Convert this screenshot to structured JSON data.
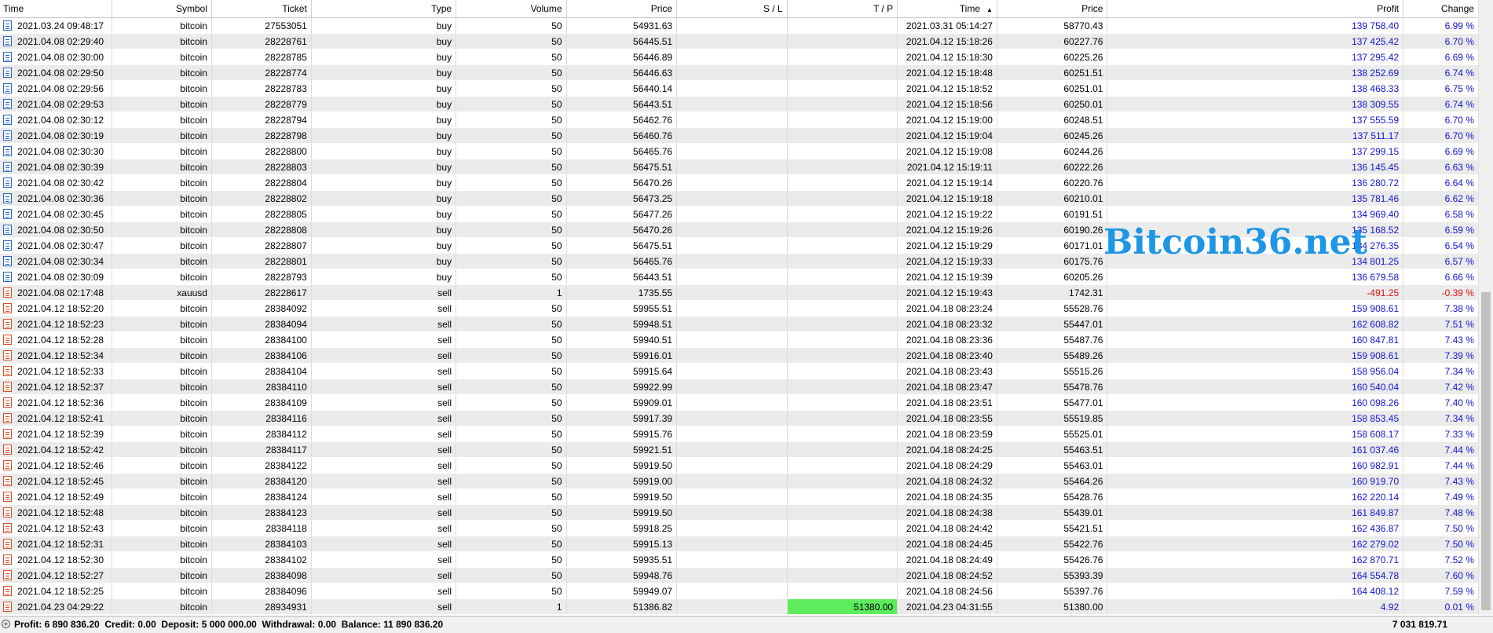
{
  "columns": {
    "time": "Time",
    "symbol": "Symbol",
    "ticket": "Ticket",
    "type": "Type",
    "volume": "Volume",
    "price": "Price",
    "sl": "S / L",
    "tp": "T / P",
    "close_time": "Time",
    "close_price": "Price",
    "profit": "Profit",
    "change": "Change"
  },
  "rows": [
    {
      "time": "2021.03.24 09:48:17",
      "symbol": "bitcoin",
      "ticket": "27553051",
      "type": "buy",
      "volume": "50",
      "price": "54931.63",
      "sl": "",
      "tp": "",
      "close_time": "2021.03.31 05:14:27",
      "close_price": "58770.43",
      "profit": "139 758.40",
      "change": "6.99 %"
    },
    {
      "time": "2021.04.08 02:29:40",
      "symbol": "bitcoin",
      "ticket": "28228761",
      "type": "buy",
      "volume": "50",
      "price": "56445.51",
      "sl": "",
      "tp": "",
      "close_time": "2021.04.12 15:18:26",
      "close_price": "60227.76",
      "profit": "137 425.42",
      "change": "6.70 %"
    },
    {
      "time": "2021.04.08 02:30:00",
      "symbol": "bitcoin",
      "ticket": "28228785",
      "type": "buy",
      "volume": "50",
      "price": "56446.89",
      "sl": "",
      "tp": "",
      "close_time": "2021.04.12 15:18:30",
      "close_price": "60225.26",
      "profit": "137 295.42",
      "change": "6.69 %"
    },
    {
      "time": "2021.04.08 02:29:50",
      "symbol": "bitcoin",
      "ticket": "28228774",
      "type": "buy",
      "volume": "50",
      "price": "56446.63",
      "sl": "",
      "tp": "",
      "close_time": "2021.04.12 15:18:48",
      "close_price": "60251.51",
      "profit": "138 252.69",
      "change": "6.74 %"
    },
    {
      "time": "2021.04.08 02:29:56",
      "symbol": "bitcoin",
      "ticket": "28228783",
      "type": "buy",
      "volume": "50",
      "price": "56440.14",
      "sl": "",
      "tp": "",
      "close_time": "2021.04.12 15:18:52",
      "close_price": "60251.01",
      "profit": "138 468.33",
      "change": "6.75 %"
    },
    {
      "time": "2021.04.08 02:29:53",
      "symbol": "bitcoin",
      "ticket": "28228779",
      "type": "buy",
      "volume": "50",
      "price": "56443.51",
      "sl": "",
      "tp": "",
      "close_time": "2021.04.12 15:18:56",
      "close_price": "60250.01",
      "profit": "138 309.55",
      "change": "6.74 %"
    },
    {
      "time": "2021.04.08 02:30:12",
      "symbol": "bitcoin",
      "ticket": "28228794",
      "type": "buy",
      "volume": "50",
      "price": "56462.76",
      "sl": "",
      "tp": "",
      "close_time": "2021.04.12 15:19:00",
      "close_price": "60248.51",
      "profit": "137 555.59",
      "change": "6.70 %"
    },
    {
      "time": "2021.04.08 02:30:19",
      "symbol": "bitcoin",
      "ticket": "28228798",
      "type": "buy",
      "volume": "50",
      "price": "56460.76",
      "sl": "",
      "tp": "",
      "close_time": "2021.04.12 15:19:04",
      "close_price": "60245.26",
      "profit": "137 511.17",
      "change": "6.70 %"
    },
    {
      "time": "2021.04.08 02:30:30",
      "symbol": "bitcoin",
      "ticket": "28228800",
      "type": "buy",
      "volume": "50",
      "price": "56465.76",
      "sl": "",
      "tp": "",
      "close_time": "2021.04.12 15:19:08",
      "close_price": "60244.26",
      "profit": "137 299.15",
      "change": "6.69 %"
    },
    {
      "time": "2021.04.08 02:30:39",
      "symbol": "bitcoin",
      "ticket": "28228803",
      "type": "buy",
      "volume": "50",
      "price": "56475.51",
      "sl": "",
      "tp": "",
      "close_time": "2021.04.12 15:19:11",
      "close_price": "60222.26",
      "profit": "136 145.45",
      "change": "6.63 %"
    },
    {
      "time": "2021.04.08 02:30:42",
      "symbol": "bitcoin",
      "ticket": "28228804",
      "type": "buy",
      "volume": "50",
      "price": "56470.26",
      "sl": "",
      "tp": "",
      "close_time": "2021.04.12 15:19:14",
      "close_price": "60220.76",
      "profit": "136 280.72",
      "change": "6.64 %"
    },
    {
      "time": "2021.04.08 02:30:36",
      "symbol": "bitcoin",
      "ticket": "28228802",
      "type": "buy",
      "volume": "50",
      "price": "56473.25",
      "sl": "",
      "tp": "",
      "close_time": "2021.04.12 15:19:18",
      "close_price": "60210.01",
      "profit": "135 781.46",
      "change": "6.62 %"
    },
    {
      "time": "2021.04.08 02:30:45",
      "symbol": "bitcoin",
      "ticket": "28228805",
      "type": "buy",
      "volume": "50",
      "price": "56477.26",
      "sl": "",
      "tp": "",
      "close_time": "2021.04.12 15:19:22",
      "close_price": "60191.51",
      "profit": "134 969.40",
      "change": "6.58 %"
    },
    {
      "time": "2021.04.08 02:30:50",
      "symbol": "bitcoin",
      "ticket": "28228808",
      "type": "buy",
      "volume": "50",
      "price": "56470.26",
      "sl": "",
      "tp": "",
      "close_time": "2021.04.12 15:19:26",
      "close_price": "60190.26",
      "profit": "135 168.52",
      "change": "6.59 %"
    },
    {
      "time": "2021.04.08 02:30:47",
      "symbol": "bitcoin",
      "ticket": "28228807",
      "type": "buy",
      "volume": "50",
      "price": "56475.51",
      "sl": "",
      "tp": "",
      "close_time": "2021.04.12 15:19:29",
      "close_price": "60171.01",
      "profit": "134 276.35",
      "change": "6.54 %"
    },
    {
      "time": "2021.04.08 02:30:34",
      "symbol": "bitcoin",
      "ticket": "28228801",
      "type": "buy",
      "volume": "50",
      "price": "56465.76",
      "sl": "",
      "tp": "",
      "close_time": "2021.04.12 15:19:33",
      "close_price": "60175.76",
      "profit": "134 801.25",
      "change": "6.57 %"
    },
    {
      "time": "2021.04.08 02:30:09",
      "symbol": "bitcoin",
      "ticket": "28228793",
      "type": "buy",
      "volume": "50",
      "price": "56443.51",
      "sl": "",
      "tp": "",
      "close_time": "2021.04.12 15:19:39",
      "close_price": "60205.26",
      "profit": "136 679.58",
      "change": "6.66 %"
    },
    {
      "time": "2021.04.08 02:17:48",
      "symbol": "xauusd",
      "ticket": "28228617",
      "type": "sell",
      "volume": "1",
      "price": "1735.55",
      "sl": "",
      "tp": "",
      "close_time": "2021.04.12 15:19:43",
      "close_price": "1742.31",
      "profit": "-491.25",
      "change": "-0.39 %"
    },
    {
      "time": "2021.04.12 18:52:20",
      "symbol": "bitcoin",
      "ticket": "28384092",
      "type": "sell",
      "volume": "50",
      "price": "59955.51",
      "sl": "",
      "tp": "",
      "close_time": "2021.04.18 08:23:24",
      "close_price": "55528.76",
      "profit": "159 908.61",
      "change": "7.38 %"
    },
    {
      "time": "2021.04.12 18:52:23",
      "symbol": "bitcoin",
      "ticket": "28384094",
      "type": "sell",
      "volume": "50",
      "price": "59948.51",
      "sl": "",
      "tp": "",
      "close_time": "2021.04.18 08:23:32",
      "close_price": "55447.01",
      "profit": "162 608.82",
      "change": "7.51 %"
    },
    {
      "time": "2021.04.12 18:52:28",
      "symbol": "bitcoin",
      "ticket": "28384100",
      "type": "sell",
      "volume": "50",
      "price": "59940.51",
      "sl": "",
      "tp": "",
      "close_time": "2021.04.18 08:23:36",
      "close_price": "55487.76",
      "profit": "160 847.81",
      "change": "7.43 %"
    },
    {
      "time": "2021.04.12 18:52:34",
      "symbol": "bitcoin",
      "ticket": "28384106",
      "type": "sell",
      "volume": "50",
      "price": "59916.01",
      "sl": "",
      "tp": "",
      "close_time": "2021.04.18 08:23:40",
      "close_price": "55489.26",
      "profit": "159 908.61",
      "change": "7.39 %"
    },
    {
      "time": "2021.04.12 18:52:33",
      "symbol": "bitcoin",
      "ticket": "28384104",
      "type": "sell",
      "volume": "50",
      "price": "59915.64",
      "sl": "",
      "tp": "",
      "close_time": "2021.04.18 08:23:43",
      "close_price": "55515.26",
      "profit": "158 956.04",
      "change": "7.34 %"
    },
    {
      "time": "2021.04.12 18:52:37",
      "symbol": "bitcoin",
      "ticket": "28384110",
      "type": "sell",
      "volume": "50",
      "price": "59922.99",
      "sl": "",
      "tp": "",
      "close_time": "2021.04.18 08:23:47",
      "close_price": "55478.76",
      "profit": "160 540.04",
      "change": "7.42 %"
    },
    {
      "time": "2021.04.12 18:52:36",
      "symbol": "bitcoin",
      "ticket": "28384109",
      "type": "sell",
      "volume": "50",
      "price": "59909.01",
      "sl": "",
      "tp": "",
      "close_time": "2021.04.18 08:23:51",
      "close_price": "55477.01",
      "profit": "160 098.26",
      "change": "7.40 %"
    },
    {
      "time": "2021.04.12 18:52:41",
      "symbol": "bitcoin",
      "ticket": "28384116",
      "type": "sell",
      "volume": "50",
      "price": "59917.39",
      "sl": "",
      "tp": "",
      "close_time": "2021.04.18 08:23:55",
      "close_price": "55519.85",
      "profit": "158 853.45",
      "change": "7.34 %"
    },
    {
      "time": "2021.04.12 18:52:39",
      "symbol": "bitcoin",
      "ticket": "28384112",
      "type": "sell",
      "volume": "50",
      "price": "59915.76",
      "sl": "",
      "tp": "",
      "close_time": "2021.04.18 08:23:59",
      "close_price": "55525.01",
      "profit": "158 608.17",
      "change": "7.33 %"
    },
    {
      "time": "2021.04.12 18:52:42",
      "symbol": "bitcoin",
      "ticket": "28384117",
      "type": "sell",
      "volume": "50",
      "price": "59921.51",
      "sl": "",
      "tp": "",
      "close_time": "2021.04.18 08:24:25",
      "close_price": "55463.51",
      "profit": "161 037.46",
      "change": "7.44 %"
    },
    {
      "time": "2021.04.12 18:52:46",
      "symbol": "bitcoin",
      "ticket": "28384122",
      "type": "sell",
      "volume": "50",
      "price": "59919.50",
      "sl": "",
      "tp": "",
      "close_time": "2021.04.18 08:24:29",
      "close_price": "55463.01",
      "profit": "160 982.91",
      "change": "7.44 %"
    },
    {
      "time": "2021.04.12 18:52:45",
      "symbol": "bitcoin",
      "ticket": "28384120",
      "type": "sell",
      "volume": "50",
      "price": "59919.00",
      "sl": "",
      "tp": "",
      "close_time": "2021.04.18 08:24:32",
      "close_price": "55464.26",
      "profit": "160 919.70",
      "change": "7.43 %"
    },
    {
      "time": "2021.04.12 18:52:49",
      "symbol": "bitcoin",
      "ticket": "28384124",
      "type": "sell",
      "volume": "50",
      "price": "59919.50",
      "sl": "",
      "tp": "",
      "close_time": "2021.04.18 08:24:35",
      "close_price": "55428.76",
      "profit": "162 220.14",
      "change": "7.49 %"
    },
    {
      "time": "2021.04.12 18:52:48",
      "symbol": "bitcoin",
      "ticket": "28384123",
      "type": "sell",
      "volume": "50",
      "price": "59919.50",
      "sl": "",
      "tp": "",
      "close_time": "2021.04.18 08:24:38",
      "close_price": "55439.01",
      "profit": "161 849.87",
      "change": "7.48 %"
    },
    {
      "time": "2021.04.12 18:52:43",
      "symbol": "bitcoin",
      "ticket": "28384118",
      "type": "sell",
      "volume": "50",
      "price": "59918.25",
      "sl": "",
      "tp": "",
      "close_time": "2021.04.18 08:24:42",
      "close_price": "55421.51",
      "profit": "162 436.87",
      "change": "7.50 %"
    },
    {
      "time": "2021.04.12 18:52:31",
      "symbol": "bitcoin",
      "ticket": "28384103",
      "type": "sell",
      "volume": "50",
      "price": "59915.13",
      "sl": "",
      "tp": "",
      "close_time": "2021.04.18 08:24:45",
      "close_price": "55422.76",
      "profit": "162 279.02",
      "change": "7.50 %"
    },
    {
      "time": "2021.04.12 18:52:30",
      "symbol": "bitcoin",
      "ticket": "28384102",
      "type": "sell",
      "volume": "50",
      "price": "59935.51",
      "sl": "",
      "tp": "",
      "close_time": "2021.04.18 08:24:49",
      "close_price": "55426.76",
      "profit": "162 870.71",
      "change": "7.52 %"
    },
    {
      "time": "2021.04.12 18:52:27",
      "symbol": "bitcoin",
      "ticket": "28384098",
      "type": "sell",
      "volume": "50",
      "price": "59948.76",
      "sl": "",
      "tp": "",
      "close_time": "2021.04.18 08:24:52",
      "close_price": "55393.39",
      "profit": "164 554.78",
      "change": "7.60 %"
    },
    {
      "time": "2021.04.12 18:52:25",
      "symbol": "bitcoin",
      "ticket": "28384096",
      "type": "sell",
      "volume": "50",
      "price": "59949.07",
      "sl": "",
      "tp": "",
      "close_time": "2021.04.18 08:24:56",
      "close_price": "55397.76",
      "profit": "164 408.12",
      "change": "7.59 %"
    },
    {
      "time": "2021.04.23 04:29:22",
      "symbol": "bitcoin",
      "ticket": "28934931",
      "type": "sell",
      "volume": "1",
      "price": "51386.82",
      "sl": "",
      "tp": "51380.00",
      "close_time": "2021.04.23 04:31:55",
      "close_price": "51380.00",
      "profit": "4.92",
      "change": "0.01 %"
    }
  ],
  "watermark": "Bitcoin36.net",
  "footer": {
    "summary": "Profit: 6 890 836.20  Credit: 0.00  Deposit: 5 000 000.00  Withdrawal: 0.00  Balance: 11 890 836.20",
    "total": "7 031 819.71"
  },
  "colors": {
    "profit_positive": "#1414d4",
    "profit_negative": "#e01010",
    "tp_highlight": "#5cec5c",
    "watermark": "#1e96e6"
  },
  "icons": {
    "buy_row": "document-blue-icon",
    "sell_row": "document-orange-icon",
    "sort": "sort-ascending-icon",
    "footer": "plus-circle-icon"
  }
}
